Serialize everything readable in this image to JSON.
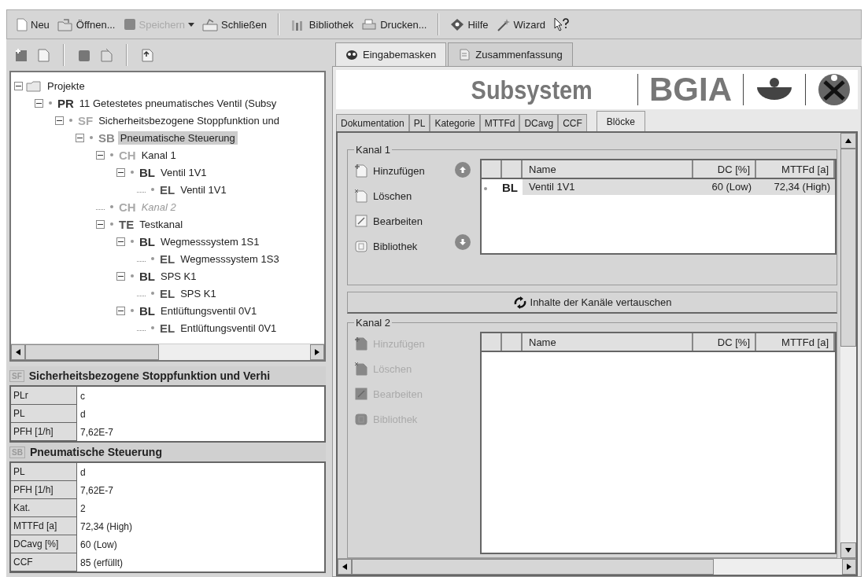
{
  "toolbar": [
    {
      "label": "Neu",
      "disabled": false,
      "dropdown": false
    },
    {
      "label": "Öffnen...",
      "disabled": false,
      "dropdown": false
    },
    {
      "label": "Speichern",
      "disabled": true,
      "dropdown": true
    },
    {
      "label": "Schließen",
      "disabled": false,
      "dropdown": false
    },
    {
      "label": "Bibliothek",
      "disabled": false,
      "dropdown": false
    },
    {
      "label": "Drucken...",
      "disabled": false,
      "dropdown": false
    },
    {
      "label": "Hilfe",
      "disabled": false,
      "dropdown": false
    },
    {
      "label": "Wizard",
      "disabled": false,
      "dropdown": false
    },
    {
      "disabled": false,
      "dropdown": false
    }
  ],
  "tree": [
    {
      "label": "Projekte",
      "expanded": true,
      "selected": false,
      "disabled": false,
      "children": [
        {
          "code": "PR",
          "label": "11 Getestetes pneumatisches Ventil (Subsy",
          "expanded": true,
          "selected": false,
          "disabled": false,
          "children": [
            {
              "code": "SF",
              "label": "Sicherheitsbezogene Stoppfunktion und",
              "expanded": true,
              "selected": false,
              "disabled": false,
              "children": [
                {
                  "code": "SB",
                  "label": "Pneumatische Steuerung",
                  "expanded": true,
                  "selected": true,
                  "disabled": false,
                  "children": [
                    {
                      "code": "CH",
                      "label": "Kanal 1",
                      "expanded": true,
                      "selected": false,
                      "disabled": false,
                      "children": [
                        {
                          "code": "BL",
                          "label": "Ventil 1V1",
                          "expanded": true,
                          "selected": false,
                          "disabled": false,
                          "children": [
                            {
                              "code": "EL",
                              "label": "Ventil 1V1",
                              "selected": false,
                              "disabled": false
                            }
                          ]
                        }
                      ]
                    },
                    {
                      "code": "CH",
                      "label": "Kanal 2",
                      "selected": false,
                      "disabled": true
                    },
                    {
                      "code": "TE",
                      "label": "Testkanal",
                      "expanded": true,
                      "selected": false,
                      "disabled": false,
                      "children": [
                        {
                          "code": "BL",
                          "label": "Wegmesssystem 1S1",
                          "expanded": true,
                          "selected": false,
                          "disabled": false,
                          "children": [
                            {
                              "code": "EL",
                              "label": "Wegmesssystem 1S3",
                              "selected": false,
                              "disabled": false
                            }
                          ]
                        },
                        {
                          "code": "BL",
                          "label": "SPS K1",
                          "expanded": true,
                          "selected": false,
                          "disabled": false,
                          "children": [
                            {
                              "code": "EL",
                              "label": "SPS K1",
                              "selected": false,
                              "disabled": false
                            }
                          ]
                        },
                        {
                          "code": "BL",
                          "label": "Entlüftungsventil 0V1",
                          "expanded": true,
                          "selected": false,
                          "disabled": false,
                          "children": [
                            {
                              "code": "EL",
                              "label": "Entlüftungsventil 0V1",
                              "selected": false,
                              "disabled": false
                            }
                          ]
                        }
                      ]
                    }
                  ]
                }
              ]
            }
          ]
        }
      ]
    }
  ],
  "properties": [
    {
      "code": "SF",
      "title": "Sicherheitsbezogene Stoppfunktion und Verhi",
      "rows": [
        {
          "label": "PLr",
          "value": "c"
        },
        {
          "label": "PL",
          "value": "d"
        },
        {
          "label": "PFH [1/h]",
          "value": "7,62E-7"
        }
      ]
    },
    {
      "code": "SB",
      "title": "Pneumatische Steuerung",
      "rows": [
        {
          "label": "PL",
          "value": "d"
        },
        {
          "label": "PFH [1/h]",
          "value": "7,62E-7"
        },
        {
          "label": "Kat.",
          "value": "2"
        },
        {
          "label": "MTTFd [a]",
          "value": "72,34 (High)"
        },
        {
          "label": "DCavg [%]",
          "value": "60 (Low)"
        },
        {
          "label": "CCF",
          "value": "85 (erfüllt)"
        }
      ]
    }
  ],
  "main_tabs": [
    {
      "label": "Eingabemasken",
      "selected": true
    },
    {
      "label": "Zusammenfassung",
      "selected": false
    }
  ],
  "banner": {
    "title": "Subsystem",
    "brand": "BGIA"
  },
  "sub_tabs": [
    {
      "label": "Dokumentation",
      "selected": false
    },
    {
      "label": "PL",
      "selected": false
    },
    {
      "label": "Kategorie",
      "selected": false
    },
    {
      "label": "MTTFd",
      "selected": false
    },
    {
      "label": "DCavg",
      "selected": false
    },
    {
      "label": "CCF",
      "selected": false
    },
    {
      "label": "Blöcke",
      "selected": true
    }
  ],
  "channels": [
    {
      "title": "Kanal 1",
      "disabled": false,
      "actions": [
        "Hinzufügen",
        "Löschen",
        "Bearbeiten",
        "Bibliothek"
      ],
      "columns": [
        "Name",
        "DC [%]",
        "MTTFd [a]"
      ],
      "rows": [
        {
          "code": "BL",
          "name": "Ventil 1V1",
          "dc": "60 (Low)",
          "mttfd": "72,34 (High)",
          "selected": true
        }
      ]
    },
    {
      "title": "Kanal 2",
      "disabled": true,
      "actions": [
        "Hinzufügen",
        "Löschen",
        "Bearbeiten",
        "Bibliothek"
      ],
      "columns": [
        "Name",
        "DC [%]",
        "MTTFd [a]"
      ]
    }
  ],
  "swap_button": "Inhalte der Kanäle vertauschen"
}
